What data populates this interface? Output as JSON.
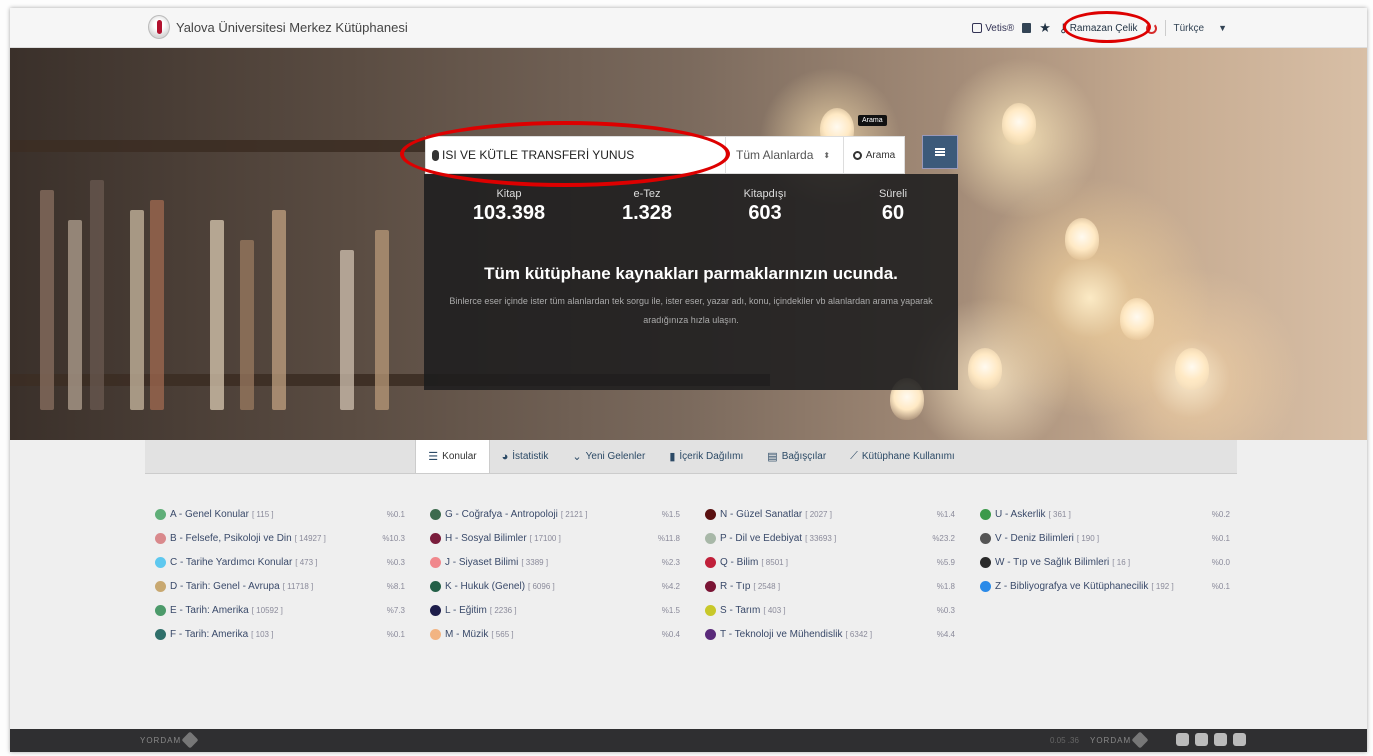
{
  "header": {
    "brand": "Yalova Üniversitesi Merkez Kütüphanesi",
    "links": {
      "vetis": "Vetis®",
      "user": "Ramazan Çelik",
      "language": "Türkçe"
    }
  },
  "search": {
    "query": "ISI VE KÜTLE TRANSFERİ YUNUS",
    "scope": "Tüm Alanlarda",
    "button": "Arama",
    "tooltip": "Arama"
  },
  "stats": [
    {
      "label": "Kitap",
      "value": "103.398"
    },
    {
      "label": "e-Tez",
      "value": "1.328"
    },
    {
      "label": "Kitapdışı",
      "value": "603"
    },
    {
      "label": "Süreli",
      "value": "60"
    }
  ],
  "hero": {
    "tagline": "Tüm kütüphane kaynakları parmaklarınızın ucunda.",
    "description": "Binlerce eser içinde ister tüm alanlardan tek sorgu ile, ister eser, yazar adı, konu, içindekiler vb alanlardan arama yaparak aradığınıza hızla ulaşın."
  },
  "tabs": [
    {
      "label": "Konular",
      "icon": "list-icon"
    },
    {
      "label": "İstatistik",
      "icon": "pie-icon"
    },
    {
      "label": "Yeni Gelenler",
      "icon": "chevrons-down-icon"
    },
    {
      "label": "İçerik Dağılımı",
      "icon": "bar-chart-icon"
    },
    {
      "label": "Bağışçılar",
      "icon": "book-icon"
    },
    {
      "label": "Kütüphane Kullanımı",
      "icon": "line-chart-icon"
    }
  ],
  "topics": [
    [
      {
        "name": "A - Genel Konular",
        "count": "[ 115 ]",
        "pct": "%0.1",
        "color": "#5fae78"
      },
      {
        "name": "B - Felsefe, Psikoloji ve Din",
        "count": "[ 14927 ]",
        "pct": "%10.3",
        "color": "#d9898c"
      },
      {
        "name": "C - Tarihe Yardımcı Konular",
        "count": "[ 473 ]",
        "pct": "%0.3",
        "color": "#5ec8ef"
      },
      {
        "name": "D - Tarih: Genel - Avrupa",
        "count": "[ 11718 ]",
        "pct": "%8.1",
        "color": "#c8a870"
      },
      {
        "name": "E - Tarih: Amerika",
        "count": "[ 10592 ]",
        "pct": "%7.3",
        "color": "#4c9a6a"
      },
      {
        "name": "F - Tarih: Amerika",
        "count": "[ 103 ]",
        "pct": "%0.1",
        "color": "#2f6f6a"
      }
    ],
    [
      {
        "name": "G - Coğrafya - Antropoloji",
        "count": "[ 2121 ]",
        "pct": "%1.5",
        "color": "#3d6b4e"
      },
      {
        "name": "H - Sosyal Bilimler",
        "count": "[ 17100 ]",
        "pct": "%11.8",
        "color": "#7a1d3c"
      },
      {
        "name": "J - Siyaset Bilimi",
        "count": "[ 3389 ]",
        "pct": "%2.3",
        "color": "#f0878c"
      },
      {
        "name": "K - Hukuk (Genel)",
        "count": "[ 6096 ]",
        "pct": "%4.2",
        "color": "#246048"
      },
      {
        "name": "L - Eğitim",
        "count": "[ 2236 ]",
        "pct": "%1.5",
        "color": "#1d1d4a"
      },
      {
        "name": "M - Müzik",
        "count": "[ 565 ]",
        "pct": "%0.4",
        "color": "#f2b482"
      }
    ],
    [
      {
        "name": "N - Güzel Sanatlar",
        "count": "[ 2027 ]",
        "pct": "%1.4",
        "color": "#5a1010"
      },
      {
        "name": "P - Dil ve Edebiyat",
        "count": "[ 33693 ]",
        "pct": "%23.2",
        "color": "#a8b8a8"
      },
      {
        "name": "Q - Bilim",
        "count": "[ 8501 ]",
        "pct": "%5.9",
        "color": "#c0203a"
      },
      {
        "name": "R - Tıp",
        "count": "[ 2548 ]",
        "pct": "%1.8",
        "color": "#7a1434"
      },
      {
        "name": "S - Tarım",
        "count": "[ 403 ]",
        "pct": "%0.3",
        "color": "#c8c82a"
      },
      {
        "name": "T - Teknoloji ve Mühendislik",
        "count": "[ 6342 ]",
        "pct": "%4.4",
        "color": "#5a2a7a"
      }
    ],
    [
      {
        "name": "U - Askerlik",
        "count": "[ 361 ]",
        "pct": "%0.2",
        "color": "#3b9a4a"
      },
      {
        "name": "V - Deniz Bilimleri",
        "count": "[ 190 ]",
        "pct": "%0.1",
        "color": "#555555"
      },
      {
        "name": "W - Tıp ve Sağlık Bilimleri",
        "count": "[ 16 ]",
        "pct": "%0.0",
        "color": "#2a2a2a"
      },
      {
        "name": "Z - Bibliyografya ve Kütüphanecilik",
        "count": "[ 192 ]",
        "pct": "%0.1",
        "color": "#2a8ae8"
      }
    ]
  ],
  "footer": {
    "brand": "YORDAM",
    "version": "0.05 .36",
    "brand_right": "YORDAM"
  }
}
